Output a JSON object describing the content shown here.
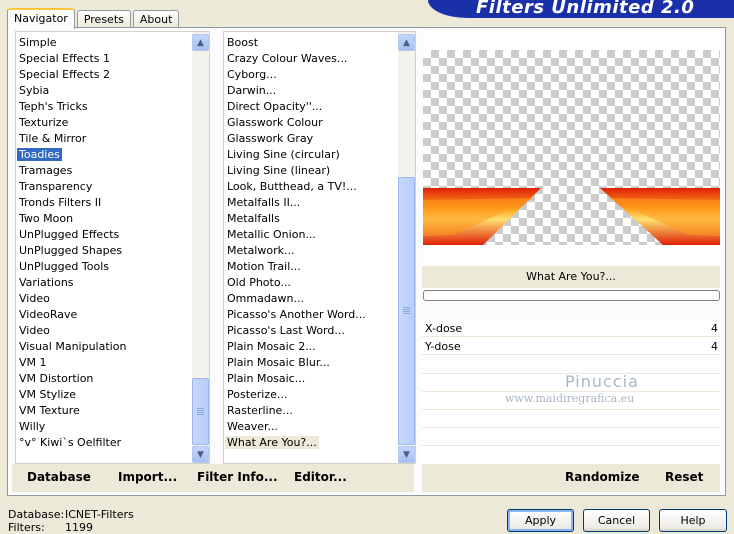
{
  "tabs": [
    "Navigator",
    "Presets",
    "About"
  ],
  "banner_title": "Filters Unlimited 2.0",
  "categories": {
    "items": [
      "Simple",
      "Special Effects 1",
      "Special Effects 2",
      "Sybia",
      "Teph's Tricks",
      "Texturize",
      "Tile & Mirror",
      "Toadies",
      "Tramages",
      "Transparency",
      "Tronds Filters II",
      "Two Moon",
      "UnPlugged Effects",
      "UnPlugged Shapes",
      "UnPlugged Tools",
      "Variations",
      "Video",
      "VideoRave",
      "Video",
      "Visual Manipulation",
      "VM 1",
      "VM Distortion",
      "VM Stylize",
      "VM Texture",
      "Willy",
      "°v° Kiwi`s Oelfilter"
    ],
    "selected": "Toadies"
  },
  "filters": {
    "items": [
      "Boost",
      "Crazy Colour Waves...",
      "Cyborg...",
      "Darwin...",
      "Direct Opacity''...",
      "Glasswork Colour",
      "Glasswork Gray",
      "Living Sine (circular)",
      "Living Sine (linear)",
      "Look, Butthead, a TV!...",
      "Metalfalls II...",
      "Metalfalls",
      "Metallic Onion...",
      "Metalwork...",
      "Motion Trail...",
      "Old Photo...",
      "Ommadawn...",
      "Picasso's Another Word...",
      "Picasso's Last Word...",
      "Plain Mosaic 2...",
      "Plain Mosaic Blur...",
      "Plain Mosaic...",
      "Posterize...",
      "Rasterline...",
      "Weaver...",
      "What Are You?..."
    ],
    "selected": "What Are You?..."
  },
  "preview": {
    "filter_name": "What Are You?...",
    "colors": {
      "red": "#e02008",
      "orange": "#ff9a1a",
      "yellow": "#ffe070"
    }
  },
  "params": [
    {
      "label": "X-dose",
      "value": "4"
    },
    {
      "label": "Y-dose",
      "value": "4"
    }
  ],
  "watermark": {
    "name": "Pinuccia",
    "site": "www.maidiregrafica.eu"
  },
  "left_buttons": [
    "Database",
    "Import...",
    "Filter Info...",
    "Editor..."
  ],
  "right_buttons": [
    "Randomize",
    "Reset"
  ],
  "status": {
    "database_label": "Database:",
    "database_value": "ICNET-Filters",
    "filters_label": "Filters:",
    "filters_value": "1199"
  },
  "dialog_buttons": {
    "apply": "Apply",
    "cancel": "Cancel",
    "help": "Help"
  }
}
